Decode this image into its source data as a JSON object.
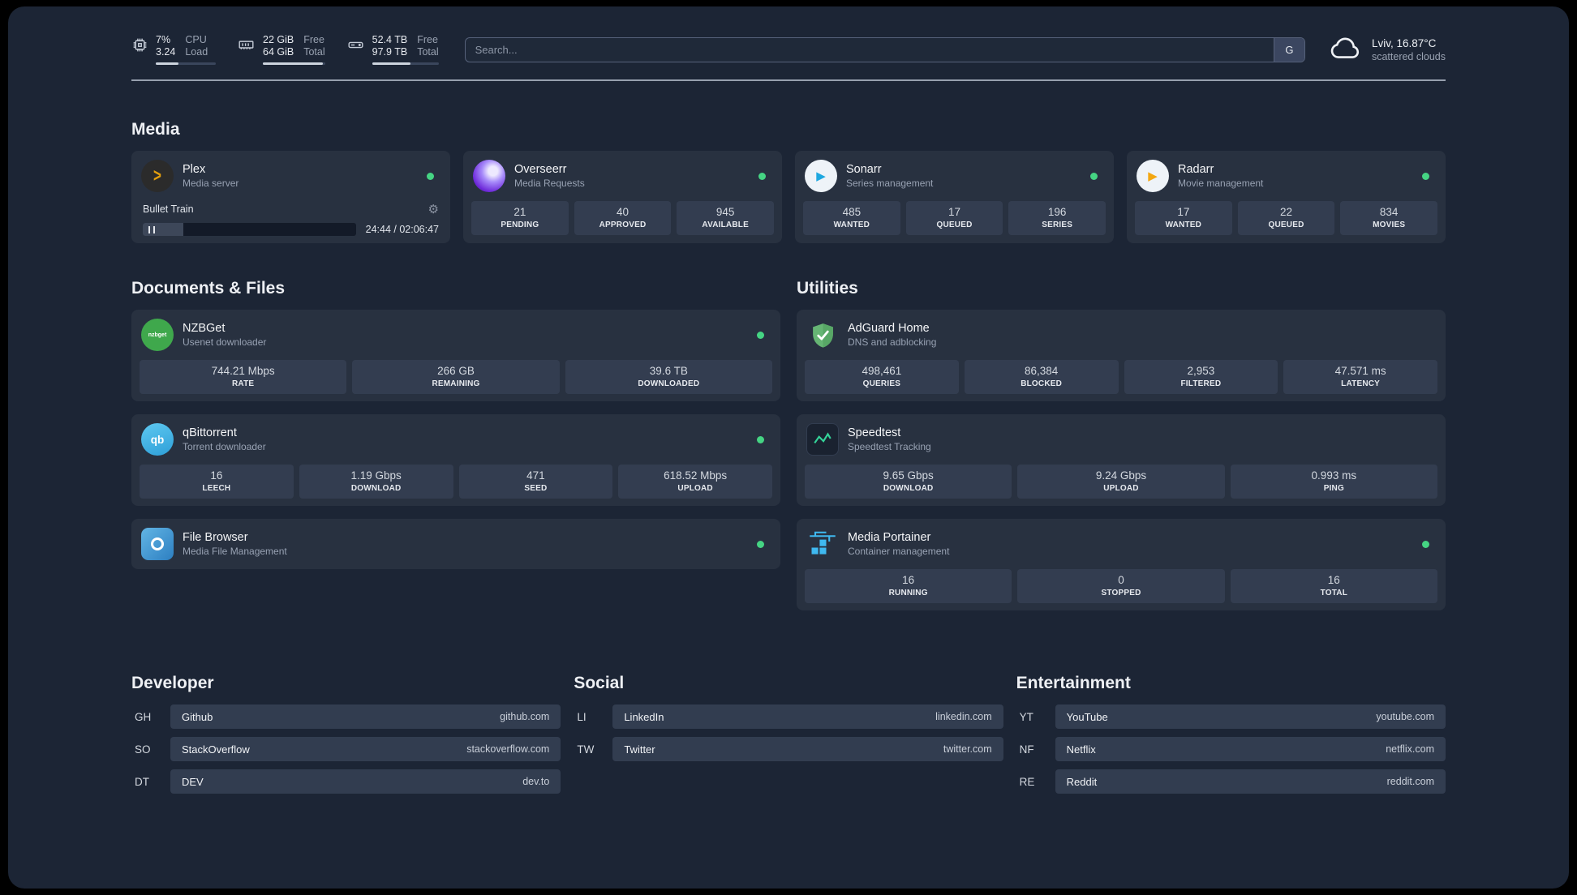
{
  "colors": {
    "status_green": "#45d483",
    "accent_amber": "#e5a00d",
    "speedline_green": "#34d399"
  },
  "icons": {
    "gear": "⚙",
    "play": "▶",
    "plex_chevron": ">",
    "qb_glyph": "qb",
    "nzbget_glyph": "nzbget"
  },
  "topbar": {
    "cpu": {
      "value_top": "7%",
      "value_bottom": "3.24",
      "label_top": "CPU",
      "label_bottom": "Load",
      "bar_pct": 38
    },
    "memory": {
      "value_top": "22 GiB",
      "value_bottom": "64 GiB",
      "label_top": "Free",
      "label_bottom": "Total",
      "bar_pct": 96
    },
    "disk": {
      "value_top": "52.4 TB",
      "value_bottom": "97.9 TB",
      "label_top": "Free",
      "label_bottom": "Total",
      "bar_pct": 58
    },
    "search": {
      "placeholder": "Search...",
      "button_label": "G"
    },
    "weather": {
      "location": "Lviv, 16.87°C",
      "condition": "scattered clouds"
    }
  },
  "sections": {
    "media": {
      "title": "Media"
    },
    "documents": {
      "title": "Documents & Files"
    },
    "utilities": {
      "title": "Utilities"
    }
  },
  "services": {
    "plex": {
      "name": "Plex",
      "desc": "Media server",
      "now_playing": "Bullet Train",
      "time": "24:44 / 02:06:47",
      "progress_pct": 19
    },
    "overseerr": {
      "name": "Overseerr",
      "desc": "Media Requests",
      "stats": [
        {
          "value": "21",
          "label": "PENDING"
        },
        {
          "value": "40",
          "label": "APPROVED"
        },
        {
          "value": "945",
          "label": "AVAILABLE"
        }
      ]
    },
    "sonarr": {
      "name": "Sonarr",
      "desc": "Series management",
      "stats": [
        {
          "value": "485",
          "label": "WANTED"
        },
        {
          "value": "17",
          "label": "QUEUED"
        },
        {
          "value": "196",
          "label": "SERIES"
        }
      ]
    },
    "radarr": {
      "name": "Radarr",
      "desc": "Movie management",
      "stats": [
        {
          "value": "17",
          "label": "WANTED"
        },
        {
          "value": "22",
          "label": "QUEUED"
        },
        {
          "value": "834",
          "label": "MOVIES"
        }
      ]
    },
    "nzbget": {
      "name": "NZBGet",
      "desc": "Usenet downloader",
      "stats": [
        {
          "value": "744.21 Mbps",
          "label": "RATE"
        },
        {
          "value": "266 GB",
          "label": "REMAINING"
        },
        {
          "value": "39.6 TB",
          "label": "DOWNLOADED"
        }
      ]
    },
    "qbittorrent": {
      "name": "qBittorrent",
      "desc": "Torrent downloader",
      "stats": [
        {
          "value": "16",
          "label": "LEECH"
        },
        {
          "value": "1.19 Gbps",
          "label": "DOWNLOAD"
        },
        {
          "value": "471",
          "label": "SEED"
        },
        {
          "value": "618.52 Mbps",
          "label": "UPLOAD"
        }
      ]
    },
    "filebrowser": {
      "name": "File Browser",
      "desc": "Media File Management"
    },
    "adguard": {
      "name": "AdGuard Home",
      "desc": "DNS and adblocking",
      "stats": [
        {
          "value": "498,461",
          "label": "QUERIES"
        },
        {
          "value": "86,384",
          "label": "BLOCKED"
        },
        {
          "value": "2,953",
          "label": "FILTERED"
        },
        {
          "value": "47.571 ms",
          "label": "LATENCY"
        }
      ]
    },
    "speedtest": {
      "name": "Speedtest",
      "desc": "Speedtest Tracking",
      "stats": [
        {
          "value": "9.65 Gbps",
          "label": "DOWNLOAD"
        },
        {
          "value": "9.24 Gbps",
          "label": "UPLOAD"
        },
        {
          "value": "0.993 ms",
          "label": "PING"
        }
      ]
    },
    "portainer": {
      "name": "Media Portainer",
      "desc": "Container management",
      "stats": [
        {
          "value": "16",
          "label": "RUNNING"
        },
        {
          "value": "0",
          "label": "STOPPED"
        },
        {
          "value": "16",
          "label": "TOTAL"
        }
      ]
    }
  },
  "bookmarks": [
    {
      "title": "Developer",
      "items": [
        {
          "abbr": "GH",
          "name": "Github",
          "url": "github.com"
        },
        {
          "abbr": "SO",
          "name": "StackOverflow",
          "url": "stackoverflow.com"
        },
        {
          "abbr": "DT",
          "name": "DEV",
          "url": "dev.to"
        }
      ]
    },
    {
      "title": "Social",
      "items": [
        {
          "abbr": "LI",
          "name": "LinkedIn",
          "url": "linkedin.com"
        },
        {
          "abbr": "TW",
          "name": "Twitter",
          "url": "twitter.com"
        }
      ]
    },
    {
      "title": "Entertainment",
      "items": [
        {
          "abbr": "YT",
          "name": "YouTube",
          "url": "youtube.com"
        },
        {
          "abbr": "NF",
          "name": "Netflix",
          "url": "netflix.com"
        },
        {
          "abbr": "RE",
          "name": "Reddit",
          "url": "reddit.com"
        }
      ]
    }
  ]
}
